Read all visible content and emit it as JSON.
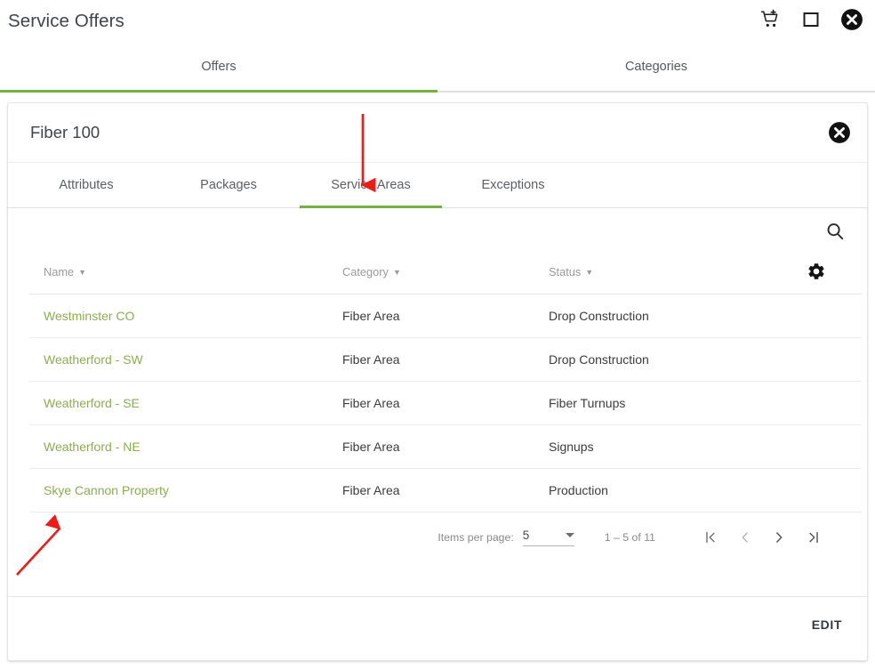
{
  "appbar": {
    "title": "Service Offers",
    "icons": [
      {
        "name": "add-shopping-cart-icon",
        "glyph": "cart"
      },
      {
        "name": "maximize-window-icon",
        "glyph": "square"
      },
      {
        "name": "close-window-icon",
        "glyph": "circle-x"
      }
    ]
  },
  "tabs": [
    {
      "label": "Offers",
      "active": true
    },
    {
      "label": "Categories",
      "active": false
    }
  ],
  "card": {
    "title": "Fiber 100",
    "close_label": "",
    "subtabs": [
      {
        "label": "Attributes",
        "active": false
      },
      {
        "label": "Packages",
        "active": false
      },
      {
        "label": "Service Areas",
        "active": true
      },
      {
        "label": "Exceptions",
        "active": false
      }
    ]
  },
  "table": {
    "columns": [
      {
        "label": "Name",
        "sort": "▼"
      },
      {
        "label": "Category",
        "sort": "▼"
      },
      {
        "label": "Status",
        "sort": "▼"
      }
    ],
    "rows": [
      {
        "name": "Westminster CO",
        "category": "Fiber Area",
        "status": "Drop Construction"
      },
      {
        "name": "Weatherford - SW",
        "category": "Fiber Area",
        "status": "Drop Construction"
      },
      {
        "name": "Weatherford - SE",
        "category": "Fiber Area",
        "status": "Fiber Turnups"
      },
      {
        "name": "Weatherford - NE",
        "category": "Fiber Area",
        "status": "Signups"
      },
      {
        "name": "Skye Cannon Property",
        "category": "Fiber Area",
        "status": "Production"
      }
    ]
  },
  "paginator": {
    "items_per_page_label": "Items per page:",
    "items_per_page_value": "5",
    "range_label": "1 – 5 of 11",
    "first_page_title": "First page",
    "previous_page_title": "Previous page",
    "next_page_title": "Next page",
    "last_page_title": "Last page"
  },
  "footer": {
    "edit_label": "EDIT"
  },
  "colors": {
    "accent_green": "#76b043",
    "link_green": "#8cae4f",
    "annotation_red": "#ee1c17",
    "text_primary": "#3c3c3c",
    "text_muted": "#9b9b9b"
  }
}
